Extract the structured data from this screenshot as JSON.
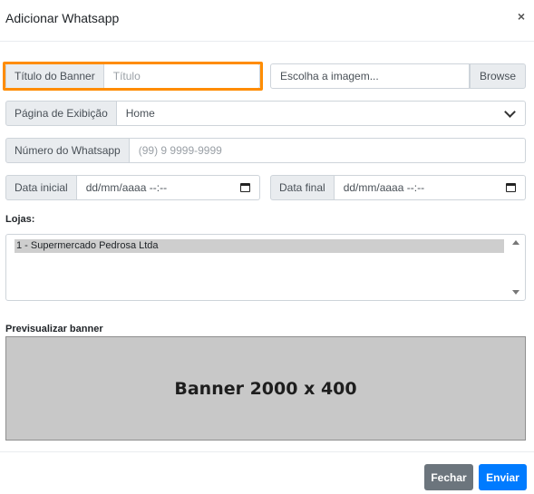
{
  "modal": {
    "title": "Adicionar Whatsapp",
    "close_symbol": "×"
  },
  "form": {
    "titulo": {
      "label": "Título do Banner",
      "placeholder": "Título",
      "value": ""
    },
    "imagem": {
      "text": "Escolha a imagem...",
      "browse_label": "Browse"
    },
    "pagina": {
      "label": "Página de Exibição",
      "selected": "Home"
    },
    "whatsapp": {
      "label": "Número do Whatsapp",
      "placeholder": "(99) 9 9999-9999",
      "value": ""
    },
    "data_inicial": {
      "label": "Data inicial",
      "value": "dd/mm/aaaa --:--"
    },
    "data_final": {
      "label": "Data final",
      "value": "dd/mm/aaaa --:--"
    },
    "lojas": {
      "label": "Lojas:",
      "options": [
        "1 - Supermercado Pedrosa Ltda"
      ]
    }
  },
  "preview": {
    "label": "Previsualizar banner",
    "banner_text": "Banner 2000 x 400"
  },
  "footer": {
    "close_label": "Fechar",
    "send_label": "Enviar"
  },
  "colors": {
    "highlight": "#ff8c00",
    "primary": "#007bff",
    "secondary": "#6c757d"
  },
  "icons": {
    "close": "close-icon",
    "select": "chevron-down-icon",
    "calendar": "calendar-icon"
  }
}
